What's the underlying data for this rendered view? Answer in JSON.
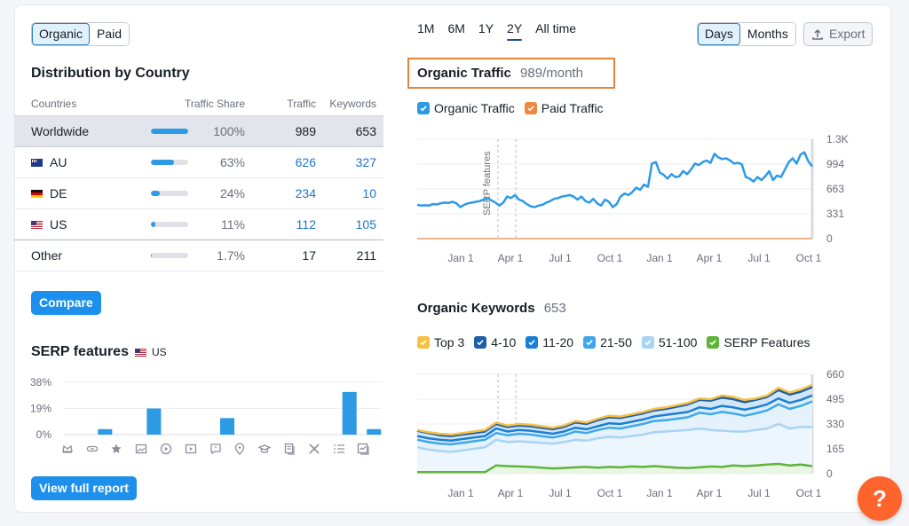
{
  "source_toggle": {
    "options": [
      "Organic",
      "Paid"
    ],
    "active": "Organic"
  },
  "distribution": {
    "title": "Distribution by Country",
    "columns": [
      "Countries",
      "Traffic Share",
      "Traffic",
      "Keywords"
    ],
    "rows": [
      {
        "country": "Worldwide",
        "flag": "",
        "share_pct": 100,
        "share_label": "100%",
        "traffic": "989",
        "keywords": "653",
        "linked": false
      },
      {
        "country": "AU",
        "flag": "au",
        "share_pct": 63,
        "share_label": "63%",
        "traffic": "626",
        "keywords": "327",
        "linked": true
      },
      {
        "country": "DE",
        "flag": "de",
        "share_pct": 24,
        "share_label": "24%",
        "traffic": "234",
        "keywords": "10",
        "linked": true
      },
      {
        "country": "US",
        "flag": "us",
        "share_pct": 11,
        "share_label": "11%",
        "traffic": "112",
        "keywords": "105",
        "linked": true
      },
      {
        "country": "Other",
        "flag": "",
        "share_pct": 1.7,
        "share_label": "1.7%",
        "traffic": "17",
        "keywords": "211",
        "linked": false
      }
    ],
    "compare_label": "Compare"
  },
  "serp": {
    "title": "SERP features",
    "country": "US",
    "view_full_report_label": "View full report"
  },
  "time_range": {
    "options": [
      "1M",
      "6M",
      "1Y",
      "2Y",
      "All time"
    ],
    "active": "2Y"
  },
  "granularity": {
    "options": [
      "Days",
      "Months"
    ],
    "active": "Days"
  },
  "export_label": "Export",
  "traffic_chart_header": {
    "title": "Organic Traffic",
    "value": "989/month"
  },
  "traffic_legend": [
    {
      "label": "Organic Traffic",
      "color": "#2d9ae6"
    },
    {
      "label": "Paid Traffic",
      "color": "#f0883e"
    }
  ],
  "keywords_chart_header": {
    "title": "Organic Keywords",
    "value": "653"
  },
  "keywords_legend": [
    {
      "label": "Top 3",
      "color": "#f6c142"
    },
    {
      "label": "4-10",
      "color": "#1f5fa8"
    },
    {
      "label": "11-20",
      "color": "#1a7fd6"
    },
    {
      "label": "21-50",
      "color": "#3fa8ea"
    },
    {
      "label": "51-100",
      "color": "#a8d4f4"
    },
    {
      "label": "SERP Features",
      "color": "#5fb43a"
    }
  ],
  "help_label": "?",
  "chart_data": [
    {
      "type": "bar",
      "title": "SERP features",
      "categories": [
        "featured-snippet",
        "sitelinks",
        "reviews",
        "image",
        "video",
        "featured-video",
        "people-also-ask",
        "local-pack",
        "knowledge-panel",
        "top-stories",
        "x-twitter",
        "list",
        "image-pack"
      ],
      "icons": [
        "crown-icon",
        "link-icon",
        "star-icon",
        "image-icon",
        "video-circle-icon",
        "video-square-icon",
        "faq-icon",
        "location-icon",
        "education-icon",
        "article-icon",
        "x-icon",
        "list-icon",
        "image-check-icon"
      ],
      "values": [
        0,
        4,
        0,
        19,
        0,
        0,
        12,
        0,
        0,
        0,
        0,
        31,
        4
      ],
      "yticks": [
        "38%",
        "19%",
        "0%"
      ],
      "ylim": [
        0,
        38
      ],
      "color": "#2d9ae6"
    },
    {
      "type": "line",
      "title": "Organic Traffic",
      "x_ticks": [
        "Jan 1",
        "Apr 1",
        "Jul 1",
        "Oct 1",
        "Jan 1",
        "Apr 1",
        "Jul 1",
        "Oct 1"
      ],
      "y_ticks": [
        "1.3K",
        "994",
        "663",
        "331",
        "0"
      ],
      "ylim": [
        0,
        1324
      ],
      "annotation": "SERP features",
      "series": [
        {
          "name": "Organic Traffic",
          "color": "#2d9ae6",
          "values": [
            450,
            440,
            445,
            440,
            460,
            455,
            470,
            480,
            475,
            490,
            470,
            420,
            450,
            470,
            480,
            490,
            500,
            520,
            540,
            510,
            480,
            440,
            480,
            560,
            540,
            580,
            520,
            500,
            460,
            430,
            420,
            440,
            450,
            480,
            500,
            530,
            540,
            560,
            570,
            580,
            560,
            520,
            560,
            500,
            480,
            530,
            470,
            440,
            520,
            490,
            420,
            460,
            560,
            600,
            580,
            620,
            680,
            650,
            720,
            690,
            1000,
            1020,
            880,
            850,
            800,
            860,
            820,
            830,
            900,
            860,
            920,
            1000,
            980,
            1020,
            1040,
            1010,
            1130,
            1080,
            1060,
            1070,
            1040,
            1000,
            1010,
            990,
            820,
            800,
            760,
            820,
            780,
            830,
            900,
            780,
            840,
            820,
            920,
            1020,
            1070,
            1000,
            1120,
            1150,
            1030,
            960
          ]
        },
        {
          "name": "Paid Traffic",
          "color": "#f0883e",
          "values": [
            0,
            0,
            0,
            0,
            0,
            0,
            0,
            0
          ]
        }
      ]
    },
    {
      "type": "area",
      "title": "Organic Keywords",
      "x_ticks": [
        "Jan 1",
        "Apr 1",
        "Jul 1",
        "Oct 1",
        "Jan 1",
        "Apr 1",
        "Jul 1",
        "Oct 1"
      ],
      "y_ticks": [
        "660",
        "495",
        "330",
        "165",
        "0"
      ],
      "ylim": [
        0,
        660
      ],
      "series": [
        {
          "name": "Top 3",
          "color": "#f6c142",
          "values": [
            290,
            275,
            265,
            260,
            270,
            280,
            290,
            340,
            320,
            330,
            325,
            315,
            305,
            320,
            350,
            340,
            365,
            385,
            380,
            395,
            410,
            430,
            440,
            455,
            470,
            500,
            495,
            520,
            510,
            490,
            500,
            520,
            570,
            540,
            560,
            590
          ]
        },
        {
          "name": "4-10",
          "color": "#1f5fa8",
          "values": [
            285,
            270,
            255,
            250,
            260,
            270,
            280,
            330,
            310,
            320,
            315,
            305,
            295,
            310,
            340,
            330,
            355,
            375,
            370,
            385,
            400,
            420,
            430,
            445,
            460,
            490,
            485,
            505,
            495,
            475,
            490,
            510,
            555,
            525,
            545,
            575
          ]
        },
        {
          "name": "11-20",
          "color": "#1a7fd6",
          "values": [
            250,
            235,
            225,
            220,
            230,
            240,
            250,
            300,
            280,
            290,
            285,
            275,
            265,
            280,
            305,
            295,
            315,
            335,
            330,
            345,
            360,
            380,
            390,
            400,
            410,
            440,
            430,
            450,
            440,
            425,
            440,
            460,
            500,
            470,
            490,
            520
          ]
        },
        {
          "name": "21-50",
          "color": "#3fa8ea",
          "values": [
            225,
            210,
            200,
            195,
            205,
            215,
            225,
            270,
            255,
            265,
            260,
            250,
            240,
            255,
            280,
            270,
            290,
            305,
            300,
            315,
            330,
            350,
            355,
            365,
            375,
            405,
            395,
            410,
            400,
            385,
            400,
            420,
            460,
            430,
            450,
            480
          ]
        },
        {
          "name": "51-100",
          "color": "#a8d4f4",
          "values": [
            175,
            160,
            150,
            145,
            155,
            165,
            175,
            225,
            210,
            215,
            210,
            205,
            200,
            210,
            225,
            220,
            235,
            245,
            240,
            250,
            260,
            275,
            280,
            285,
            290,
            300,
            290,
            285,
            280,
            280,
            290,
            300,
            330,
            300,
            310,
            310
          ]
        },
        {
          "name": "SERP Features",
          "color": "#5fb43a",
          "values": [
            10,
            10,
            10,
            10,
            10,
            10,
            10,
            55,
            50,
            48,
            45,
            40,
            35,
            38,
            42,
            45,
            40,
            45,
            42,
            48,
            45,
            50,
            45,
            40,
            38,
            42,
            48,
            45,
            55,
            50,
            55,
            60,
            65,
            55,
            60,
            50
          ]
        }
      ]
    }
  ]
}
